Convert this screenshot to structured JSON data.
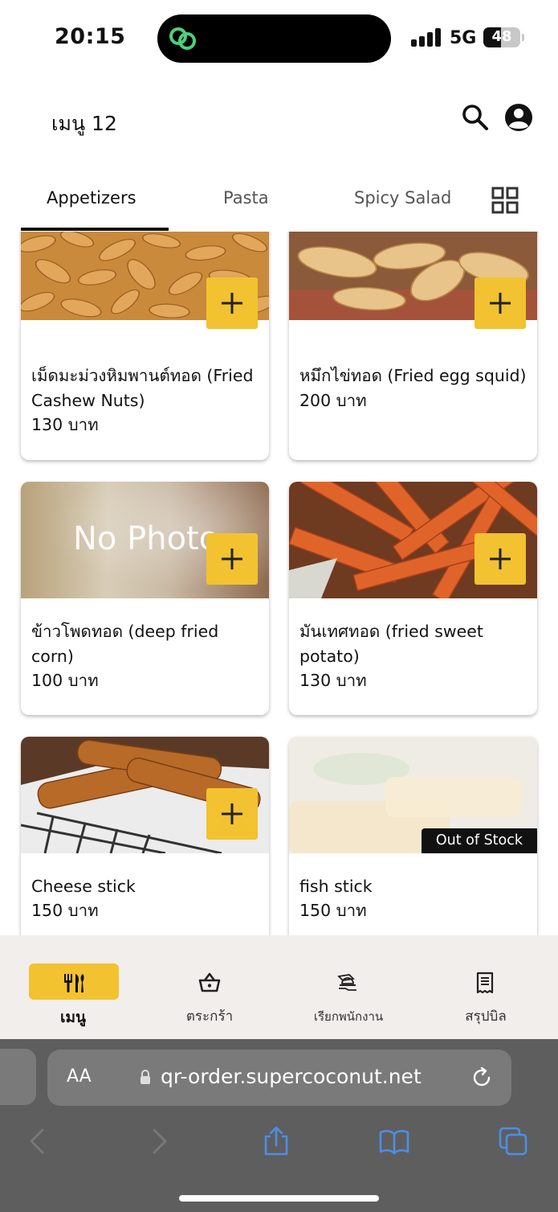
{
  "status": {
    "time": "20:15",
    "network": "5G",
    "battery": "48",
    "battery_level": 0.48,
    "app_icon": "link-chain-icon"
  },
  "header": {
    "title": "เมนู 12",
    "search_icon": "search-icon",
    "account_icon": "account-circle-icon"
  },
  "tabs": [
    {
      "label": "Appetizers",
      "active": true
    },
    {
      "label": "Pasta",
      "active": false
    },
    {
      "label": "Spicy Salad",
      "active": false
    }
  ],
  "view_toggle_icon": "grid-view-icon",
  "items": [
    {
      "name": "เม็ดมะม่วงหิมพานต์ทอด (Fried Cashew Nuts)",
      "price": "130 บาท",
      "image": "cashew-nuts-photo",
      "add_icon": "plus-icon"
    },
    {
      "name": "หมึกไข่ทอด (Fried egg squid)",
      "price": "200 บาท",
      "image": "fried-squid-photo",
      "add_icon": "plus-icon"
    },
    {
      "name": "ข้าวโพดทอด (deep fried corn)",
      "price": "100 บาท",
      "image_text": "No Photo",
      "add_icon": "plus-icon"
    },
    {
      "name": "มันเทศทอด (fried sweet potato)",
      "price": "130 บาท",
      "image": "sweet-potato-fries-photo",
      "add_icon": "plus-icon"
    },
    {
      "name": "Cheese stick",
      "price": "150 บาท",
      "image": "cheese-stick-photo",
      "add_icon": "plus-icon"
    },
    {
      "name": "fish stick",
      "price": "150 บาท",
      "image": "fish-stick-photo",
      "badge": "Out of Stock"
    }
  ],
  "bottom_nav": [
    {
      "label": "เมนู",
      "icon": "utensils-icon",
      "active": true
    },
    {
      "label": "ตระกร้า",
      "icon": "basket-icon",
      "active": false
    },
    {
      "label": "เรียกพนักงาน",
      "icon": "call-waiter-icon",
      "active": false
    },
    {
      "label": "สรุปบิล",
      "icon": "receipt-icon",
      "active": false
    }
  ],
  "browser": {
    "text_size": "AA",
    "url": "qr-order.supercoconut.net"
  },
  "colors": {
    "accent": "#f2c230",
    "nav_bg": "#f2eeec",
    "browser_bg": "#5e5e5e",
    "browser_icon": "#4a8fe8"
  }
}
